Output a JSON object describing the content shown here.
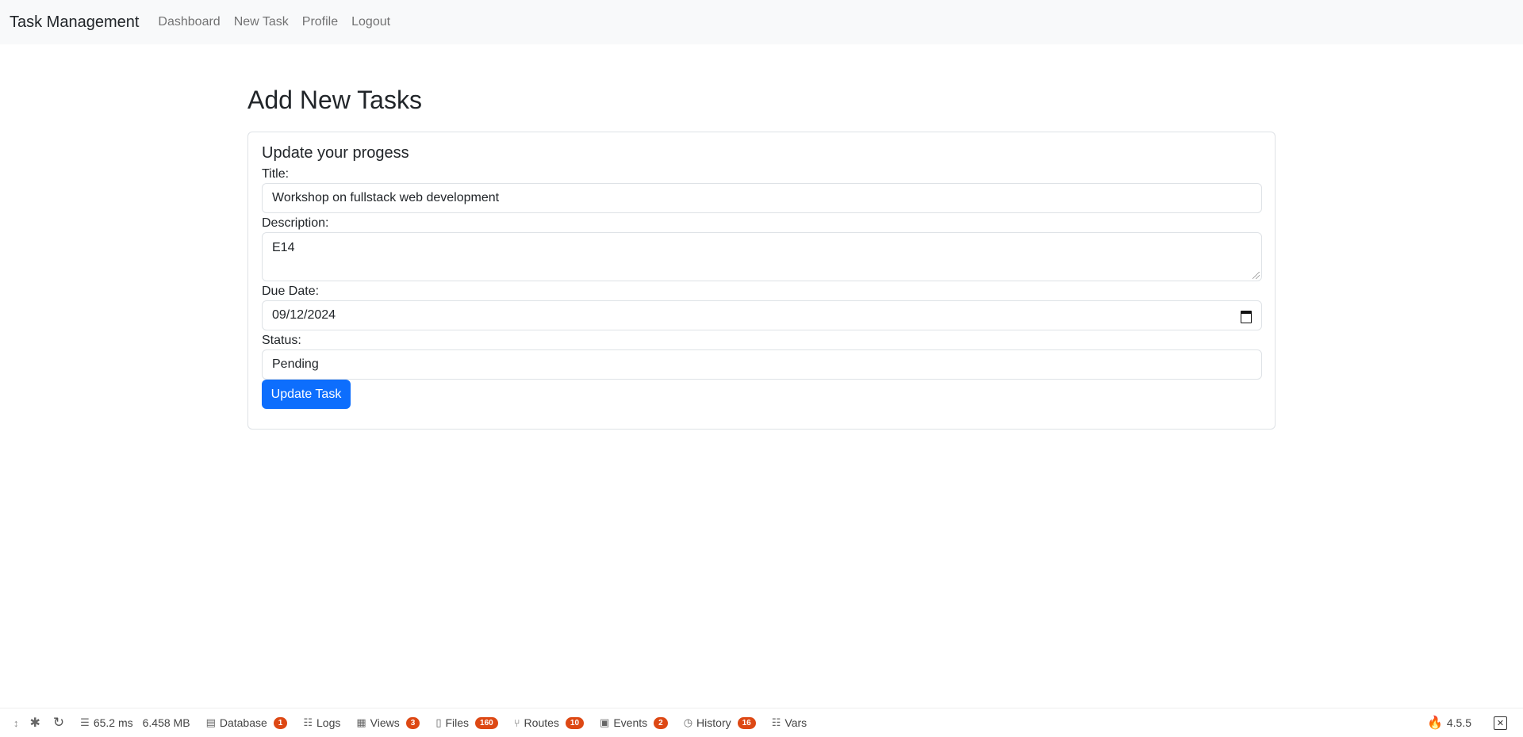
{
  "navbar": {
    "brand": "Task Management",
    "links": [
      "Dashboard",
      "New Task",
      "Profile",
      "Logout"
    ]
  },
  "main": {
    "page_title": "Add New Tasks",
    "card_title": "Update your progess",
    "title_label": "Title:",
    "title_value": "Workshop on fullstack web development",
    "description_label": "Description:",
    "description_value": "E14",
    "due_date_label": "Due Date:",
    "due_date_value": "09/12/2024",
    "status_label": "Status:",
    "status_value": "Pending",
    "submit_label": "Update Task"
  },
  "toolbar": {
    "time": "65.2 ms",
    "memory": "6.458 MB",
    "items": [
      {
        "label": "Database",
        "badge": "1",
        "icon": "database-icon"
      },
      {
        "label": "Logs",
        "badge": "",
        "icon": "list-icon"
      },
      {
        "label": "Views",
        "badge": "3",
        "icon": "views-icon"
      },
      {
        "label": "Files",
        "badge": "160",
        "icon": "files-icon"
      },
      {
        "label": "Routes",
        "badge": "10",
        "icon": "routes-icon"
      },
      {
        "label": "Events",
        "badge": "2",
        "icon": "events-icon"
      },
      {
        "label": "History",
        "badge": "16",
        "icon": "history-icon"
      },
      {
        "label": "Vars",
        "badge": "",
        "icon": "list-icon"
      }
    ],
    "version": "4.5.5"
  },
  "colors": {
    "primary": "#0d6efd",
    "badge": "#dd4814",
    "navbar_bg": "#f8f9fa"
  }
}
